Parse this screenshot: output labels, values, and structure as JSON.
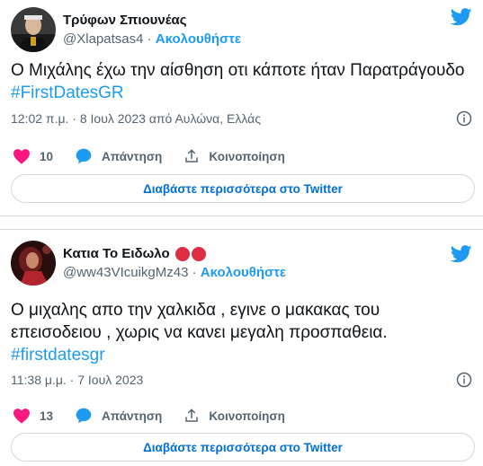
{
  "tweets": [
    {
      "name": "Τρύφων Σπιουνέας",
      "handle": "@Xlapatsas4",
      "follow_label": "Ακολουθήστε",
      "text_plain": "Ο Μιχάλης έχω την αίσθηση οτι κάποτε ήταν Παρατράγουδο ",
      "hashtag": "#FirstDatesGR",
      "meta": "12:02 π.μ. · 8 Ιουλ 2023 από Αυλώνα, Ελλάς",
      "likes": "10",
      "reply_label": "Απάντηση",
      "share_label": "Κοινοποίηση",
      "read_more": "Διαβάστε περισσότερα στο Twitter"
    },
    {
      "name": "Κατια Το Ειδωλο",
      "handle": "@ww43VIcuikgMz43",
      "follow_label": "Ακολουθήστε",
      "text_plain": "Ο μιχαλης απο την χαλκιδα , εγινε ο μακακας του επεισοδειου , χωρις να κανει μεγαλη προσπαθεια.",
      "hashtag": "#firstdatesgr",
      "meta": "11:38 μ.μ. · 7 Ιουλ 2023",
      "likes": "13",
      "reply_label": "Απάντηση",
      "share_label": "Κοινοποίηση",
      "read_more": "Διαβάστε περισσότερα στο Twitter"
    }
  ],
  "colors": {
    "accent": "#1d9bf0",
    "like": "#f91880",
    "text": "#0f1419",
    "muted": "#536471",
    "border": "#cfd9de"
  },
  "icons": [
    "twitter-bird-icon",
    "heart-icon",
    "reply-bubble-icon",
    "share-icon",
    "info-icon",
    "red-circle-emoji"
  ]
}
